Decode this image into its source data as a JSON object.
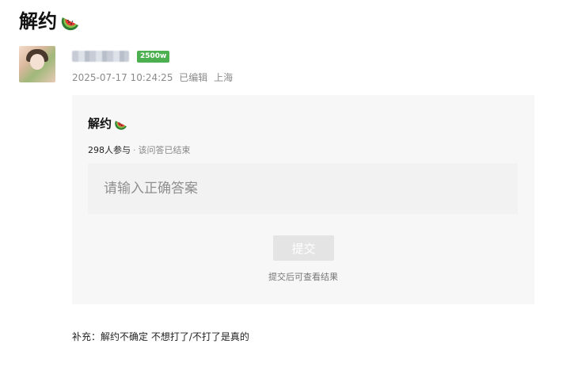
{
  "post": {
    "title": "解约",
    "title_icon": "watermelon-icon"
  },
  "author": {
    "level_badge": "2500w",
    "badge_color": "#4caf50",
    "timestamp": "2025-07-17 10:24:25",
    "edited": "已编辑",
    "location": "上海"
  },
  "quiz": {
    "title": "解约",
    "participants": "298人参与",
    "separator": "·",
    "status": "该问答已结束",
    "answer_placeholder": "请输入正确答案",
    "submit_label": "提交",
    "hint": "提交后可查看结果"
  },
  "supplement": {
    "text": "补充：解约不确定 不想打了/不打了是真的"
  }
}
